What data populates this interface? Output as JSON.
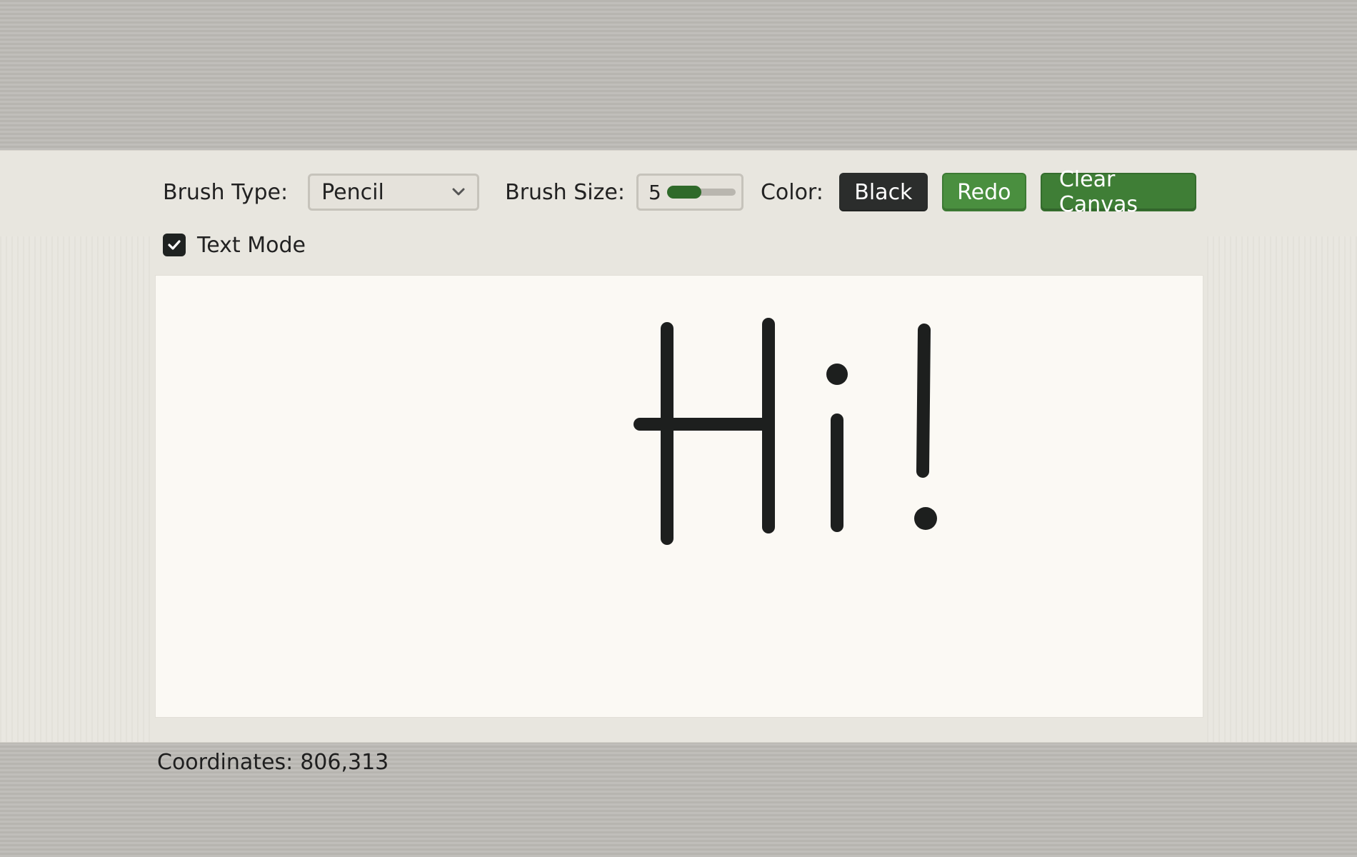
{
  "toolbar": {
    "brush_type_label": "Brush Type:",
    "brush_type_value": "Pencil",
    "brush_size_label": "Brush Size:",
    "brush_size_value": "5",
    "brush_size_level_fraction": 0.5,
    "color_label": "Color:",
    "color_button": "Black",
    "redo_button": "Redo",
    "clear_button": "Clear Canvas"
  },
  "text_mode": {
    "label": "Text Mode",
    "checked": true
  },
  "canvas": {
    "drawn_text": "Hi!",
    "stroke_color": "#1d1f1e"
  },
  "status": {
    "coordinates_label": "Coordinates:",
    "coordinates_value": "806,313"
  },
  "colors": {
    "accent_green": "#3f7e36",
    "redo_green": "#4a8f3f",
    "black_button": "#2b2d2c",
    "panel_background": "#e8e6df",
    "page_background": "#bdbbb6"
  },
  "icons": {
    "dropdown": "chevron-down-icon",
    "checkbox": "checkmark-icon"
  }
}
